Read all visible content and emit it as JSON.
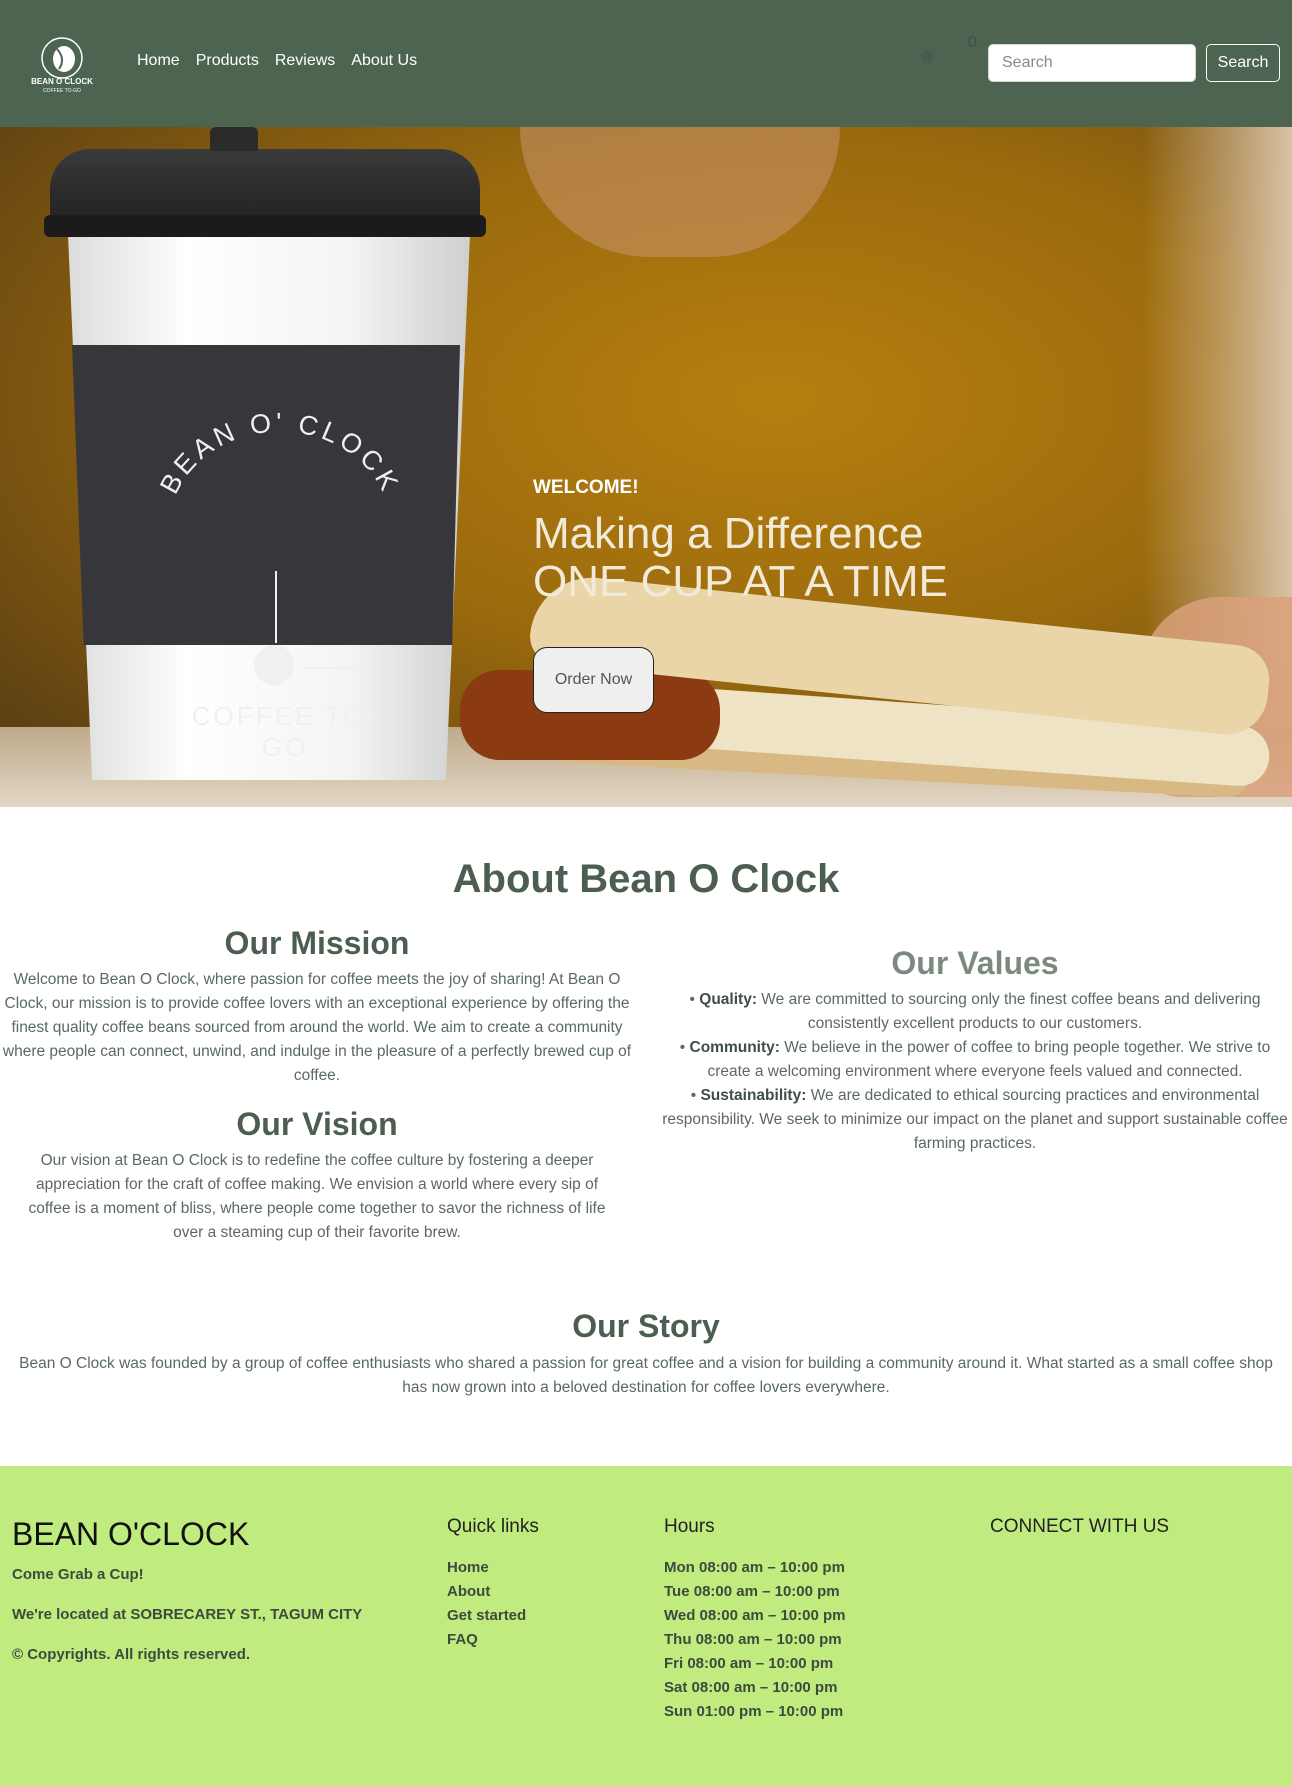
{
  "nav": {
    "logo_text": "BEAN O CLOCK",
    "logo_sub": "COFFEE TO-GO",
    "links": [
      "Home",
      "Products",
      "Reviews",
      "About Us"
    ],
    "cart_count": "0",
    "search_placeholder": "Search",
    "search_button": "Search"
  },
  "hero": {
    "welcome": "WELCOME!",
    "title_line1": "Making a Difference",
    "title_line2": "ONE CUP AT A TIME",
    "order_button": "Order Now",
    "cup_text_top": "BEAN O' CLOCK",
    "cup_text_bottom": "COFFEE TO-GO"
  },
  "about": {
    "heading": "About Bean O Clock",
    "mission": {
      "title": "Our Mission",
      "text": "Welcome to Bean O Clock, where passion for coffee meets the joy of sharing! At Bean O Clock, our mission is to provide coffee lovers with an exceptional experience by offering the finest quality coffee beans sourced from around the world. We aim to create a community where people can connect, unwind, and indulge in the pleasure of a perfectly brewed cup of coffee."
    },
    "vision": {
      "title": "Our Vision",
      "text": "Our vision at Bean O Clock is to redefine the coffee culture by fostering a deeper appreciation for the craft of coffee making. We envision a world where every sip of coffee is a moment of bliss, where people come together to savor the richness of life over a steaming cup of their favorite brew."
    },
    "values": {
      "title": "Our Values",
      "items": [
        {
          "bullet": "•",
          "label": "Quality:",
          "text": "We are committed to sourcing only the finest coffee beans and delivering consistently excellent products to our customers."
        },
        {
          "bullet": "•",
          "label": "Community:",
          "text": "We believe in the power of coffee to bring people together. We strive to create a welcoming environment where everyone feels valued and connected."
        },
        {
          "bullet": "•",
          "label": "Sustainability:",
          "text": "We are dedicated to ethical sourcing practices and environmental responsibility. We seek to minimize our impact on the planet and support sustainable coffee farming practices."
        }
      ]
    },
    "story": {
      "title": "Our Story",
      "text": "Bean O Clock was founded by a group of coffee enthusiasts who shared a passion for great coffee and a vision for building a community around it. What started as a small coffee shop has now grown into a beloved destination for coffee lovers everywhere."
    }
  },
  "footer": {
    "brand": "BEAN O'CLOCK",
    "tagline": "Come Grab a Cup!",
    "location": "We're located at SOBRECAREY ST., TAGUM CITY",
    "copyright": "© Copyrights. All rights reserved.",
    "quick_links_title": "Quick links",
    "quick_links": [
      "Home",
      "About",
      "Get started",
      "FAQ"
    ],
    "hours_title": "Hours",
    "hours": [
      "Mon 08:00 am – 10:00 pm",
      "Tue 08:00 am – 10:00 pm",
      "Wed 08:00 am – 10:00 pm",
      "Thu 08:00 am – 10:00 pm",
      "Fri 08:00 am – 10:00 pm",
      "Sat 08:00 am – 10:00 pm",
      "Sun 01:00 pm – 10:00 pm"
    ],
    "connect_title": "CONNECT WITH US"
  },
  "colors": {
    "navbar": "#4d6451",
    "footer": "#c0eb7f",
    "heading": "#4b5e50"
  }
}
